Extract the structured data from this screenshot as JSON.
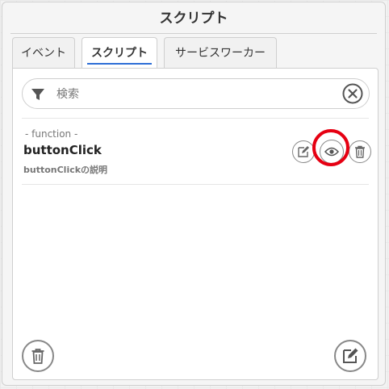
{
  "window": {
    "title": "スクリプト"
  },
  "tabs": [
    {
      "label": "イベント",
      "active": false
    },
    {
      "label": "スクリプト",
      "active": true
    },
    {
      "label": "サービスワーカー",
      "active": false
    }
  ],
  "search": {
    "placeholder": "検索",
    "value": ""
  },
  "items": [
    {
      "type": "- function -",
      "name": "buttonClick",
      "description": "buttonClickの説明"
    }
  ],
  "icons": {
    "filter": "filter-icon",
    "clear": "clear-icon",
    "edit": "pencil-icon",
    "view": "eye-icon",
    "delete": "trash-icon"
  },
  "colors": {
    "active_tab_underline": "#2d6fd6",
    "highlight": "#e60012"
  }
}
